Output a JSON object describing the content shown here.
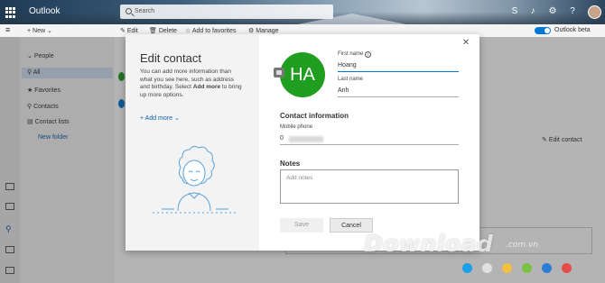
{
  "header": {
    "brand": "Outlook",
    "search_placeholder": "Search"
  },
  "toolbar": {
    "new_label": "New",
    "edit_label": "Edit",
    "delete_label": "Delete",
    "add_favorites_label": "Add to favorites",
    "manage_label": "Manage",
    "beta_label": "Outlook beta"
  },
  "folders": {
    "heading": "People",
    "items": [
      {
        "label": "All"
      },
      {
        "label": "Favorites"
      },
      {
        "label": "Contacts"
      },
      {
        "label": "Contact lists"
      }
    ],
    "new_folder": "New folder"
  },
  "reading": {
    "edit_contact": "Edit contact"
  },
  "dialog": {
    "title": "Edit contact",
    "description_start": "You can add more information than what you see here, such as address and birthday. Select ",
    "description_bold": "Add more",
    "description_end": " to bring up more options.",
    "add_more": "Add more",
    "avatar_initials": "HA",
    "first_name_label": "First name",
    "first_name_value": "Hoang",
    "last_name_label": "Last name",
    "last_name_value": "Anh",
    "contact_info_heading": "Contact information",
    "mobile_label": "Mobile phone",
    "mobile_value": "0",
    "notes_heading": "Notes",
    "notes_placeholder": "Add notes",
    "save_label": "Save",
    "cancel_label": "Cancel"
  },
  "watermark": {
    "text": "Download",
    "domain": ".com.vn",
    "dot_colors": [
      "#1aa0e8",
      "#e0e0e0",
      "#f0c040",
      "#7cc242",
      "#2a7fd4",
      "#e84a4a"
    ]
  },
  "colors": {
    "accent": "#0078d4",
    "avatar_bg": "#1f9e1f"
  }
}
